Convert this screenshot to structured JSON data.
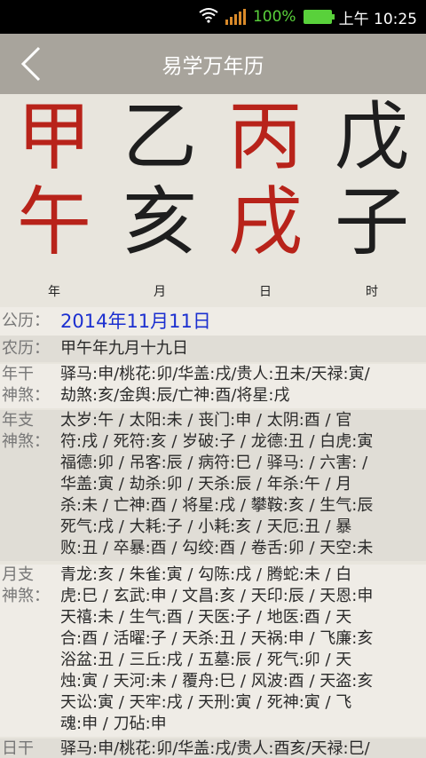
{
  "status_bar": {
    "battery_percent": "100%",
    "time": "上午 10:25"
  },
  "header": {
    "title": "易学万年历"
  },
  "ganzhi": {
    "stems": [
      "甲",
      "乙",
      "丙",
      "戊"
    ],
    "branches": [
      "午",
      "亥",
      "戌",
      "子"
    ],
    "labels": [
      "年",
      "月",
      "日",
      "时"
    ]
  },
  "info": {
    "solar_label": "公历：",
    "solar_value": "2014年11月11日",
    "lunar_label": "农历：",
    "lunar_value": "甲午年九月十九日",
    "rows": [
      {
        "label": "年干\n神煞：",
        "value": "驿马:申/桃花:卯/华盖:戌/贵人:丑未/天禄:寅/\n劫煞:亥/金舆:辰/亡神:酉/将星:戌"
      },
      {
        "label": "年支\n神煞：",
        "value": "太岁:午 / 太阳:未 / 丧门:申 / 太阴:酉 / 官\n符:戌 / 死符:亥 / 岁破:子 / 龙德:丑 / 白虎:寅\n福德:卯 / 吊客:辰 / 病符:巳 / 驿马: / 六害: /\n华盖:寅 / 劫杀:卯 / 天杀:辰 / 年杀:午 / 月\n杀:未 / 亡神:酉 / 将星:戌 / 攀鞍:亥 / 生气:辰\n死气:戌 / 大耗:子 / 小耗:亥 / 天厄:丑 / 暴\n败:丑 / 卒暴:酉 / 勾绞:酉 / 卷舌:卯 / 天空:未"
      },
      {
        "label": "月支\n神煞：",
        "value": "青龙:亥 / 朱雀:寅 / 勾陈:戌 / 腾蛇:未 / 白\n虎:巳 / 玄武:申 / 文昌:亥 / 天印:辰 / 天恩:申\n天禧:未 / 生气:酉 / 天医:子 / 地医:酉 / 天\n合:酉 / 活曜:子 / 天杀:丑 / 天祸:申 / 飞廉:亥\n浴盆:丑 / 三丘:戌 / 五墓:辰 / 死气:卯 / 天\n烛:寅 / 天河:未 / 覆舟:巳 / 风波:酉 / 天盗:亥\n天讼:寅 / 天牢:戌 / 天刑:寅 / 死神:寅 / 飞\n魂:申 / 刀砧:申"
      },
      {
        "label": "日干",
        "value": "驿马:申/桃花:卯/华盖:戌/贵人:酉亥/天禄:巳/"
      }
    ]
  },
  "colors": {
    "accent_red": "#b8231a",
    "link_blue": "#1b2fd0",
    "header_bg": "#a8a49c"
  }
}
